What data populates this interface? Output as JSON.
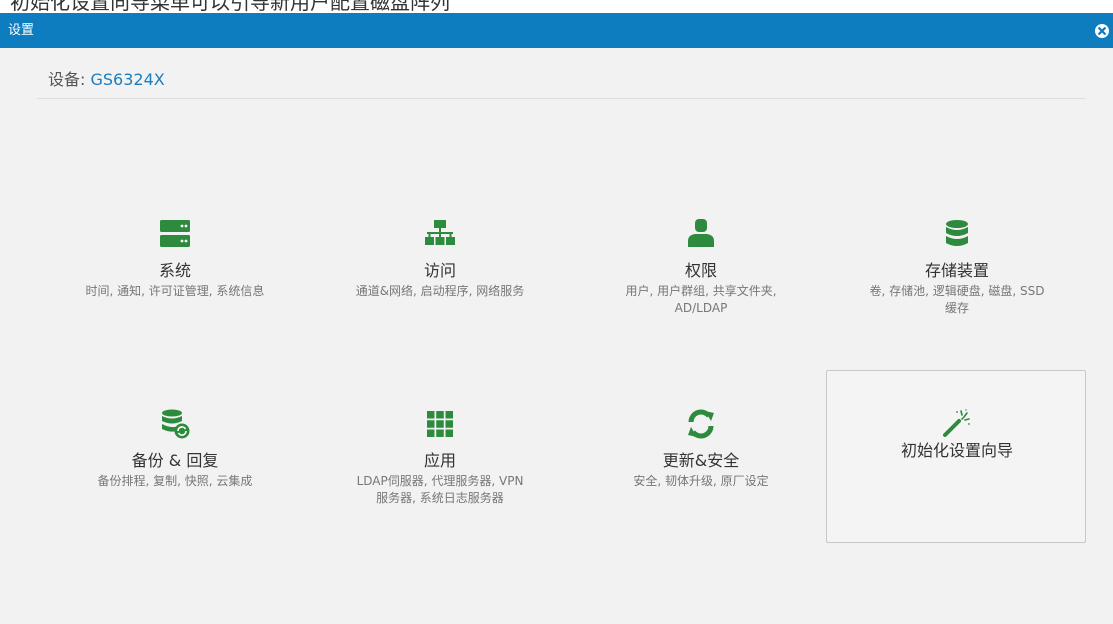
{
  "caption": "初始化设置向导菜单可以引导新用户配置磁盘阵列",
  "window": {
    "title": "设置"
  },
  "device": {
    "label": "设备:",
    "value": "GS6324X"
  },
  "colors": {
    "titlebar": "#0e7dbf",
    "accent_green": "#2e8b3e",
    "link": "#1a7dbd"
  },
  "tiles": [
    {
      "name": "系统",
      "desc": "时间, 通知, 许可证管理, 系统信息",
      "icon": "server-icon"
    },
    {
      "name": "访问",
      "desc": "通道&网络, 启动程序, 网络服务",
      "icon": "network-icon"
    },
    {
      "name": "权限",
      "desc": "用户, 用户群组, 共享文件夹, AD/LDAP",
      "icon": "user-icon"
    },
    {
      "name": "存储装置",
      "desc": "卷, 存储池, 逻辑硬盘, 磁盘, SSD 缓存",
      "icon": "database-icon"
    },
    {
      "name": "备份 & 回复",
      "desc": "备份排程, 复制, 快照, 云集成",
      "icon": "backup-icon"
    },
    {
      "name": "应用",
      "desc": "LDAP伺服器, 代理服务器, VPN 服务器, 系统日志服务器",
      "icon": "grid-icon"
    },
    {
      "name": "更新&安全",
      "desc": "安全, 韧体升级, 原厂设定",
      "icon": "refresh-icon"
    },
    {
      "name": "初始化设置向导",
      "desc": "",
      "icon": "magic-wand-icon"
    }
  ]
}
